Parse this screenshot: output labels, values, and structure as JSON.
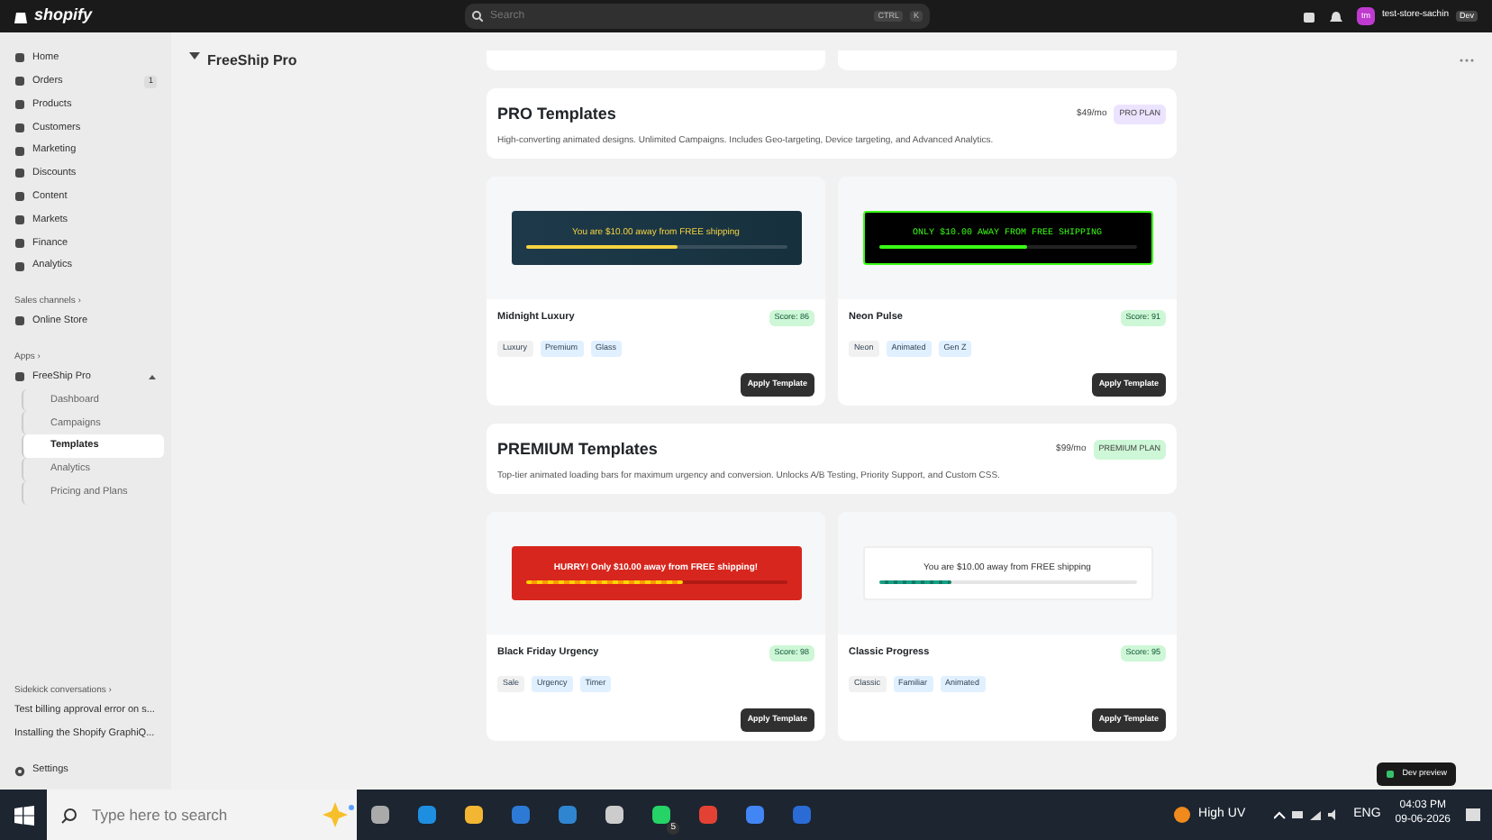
{
  "topbar": {
    "logo": "shopify",
    "search": {
      "placeholder": "Search",
      "keys": [
        "CTRL",
        "K"
      ]
    },
    "store": {
      "initials": "tm",
      "name": "test-store-sachin",
      "badge": "Dev"
    }
  },
  "sidebar": {
    "items": [
      {
        "label": "Home"
      },
      {
        "label": "Orders",
        "count": "1"
      },
      {
        "label": "Products"
      },
      {
        "label": "Customers"
      },
      {
        "label": "Marketing"
      },
      {
        "label": "Discounts"
      },
      {
        "label": "Content"
      },
      {
        "label": "Markets"
      },
      {
        "label": "Finance"
      },
      {
        "label": "Analytics"
      }
    ],
    "sales_heading": "Sales channels ›",
    "sales": [
      {
        "label": "Online Store"
      }
    ],
    "apps_heading": "Apps ›",
    "app": {
      "label": "FreeShip Pro",
      "expanded": true,
      "children": [
        {
          "label": "Dashboard",
          "selected": false
        },
        {
          "label": "Campaigns",
          "selected": false
        },
        {
          "label": "Templates",
          "selected": true
        },
        {
          "label": "Analytics",
          "selected": false
        },
        {
          "label": "Pricing and Plans",
          "selected": false
        }
      ]
    },
    "sidekick_heading": "Sidekick conversations ›",
    "sidekick": [
      "Test billing approval error on s...",
      "Installing the Shopify GraphiQ..."
    ],
    "settings": "Settings"
  },
  "app_title": "FreeShip Pro",
  "sections": [
    {
      "title": "PRO Templates",
      "price": "$49/mo",
      "plan": "PRO PLAN",
      "color": "#ece4ff",
      "description": "High-converting animated designs. Unlimited Campaigns. Includes Geo-targeting, Device targeting, and Advanced Analytics.",
      "templates": [
        {
          "name": "Midnight Luxury",
          "score": "Score: 86",
          "kind": "luxury",
          "message": "You are $10.00 away from FREE shipping",
          "level": 0.58,
          "tags": [
            {
              "label": "Luxury",
              "color": "#f1f1f1"
            },
            {
              "label": "Premium",
              "color": "#e0f0ff"
            },
            {
              "label": "Glass",
              "color": "#e0f0ff"
            }
          ],
          "button": "Apply Template"
        },
        {
          "name": "Neon Pulse",
          "score": "Score: 91",
          "kind": "neon",
          "message": "ONLY $10.00 AWAY FROM FREE SHIPPING",
          "level": 0.58,
          "tags": [
            {
              "label": "Neon",
              "color": "#f1f1f1"
            },
            {
              "label": "Animated",
              "color": "#e0f0ff"
            },
            {
              "label": "Gen Z",
              "color": "#e0f0ff"
            }
          ],
          "button": "Apply Template"
        }
      ]
    },
    {
      "title": "PREMIUM Templates",
      "price": "$99/mo",
      "plan": "PREMIUM PLAN",
      "color": "#cdf7d6",
      "description": "Top-tier animated loading bars for maximum urgency and conversion. Unlocks A/B Testing, Priority Support, and Custom CSS.",
      "templates": [
        {
          "name": "Black Friday Urgency",
          "score": "Score: 98",
          "kind": "urgency",
          "message": "HURRY! Only $10.00 away from FREE shipping!",
          "level": 0.6,
          "tags": [
            {
              "label": "Sale",
              "color": "#f1f1f1"
            },
            {
              "label": "Urgency",
              "color": "#e0f0ff"
            },
            {
              "label": "Timer",
              "color": "#e0f0ff"
            }
          ],
          "button": "Apply Template"
        },
        {
          "name": "Classic Progress",
          "score": "Score: 95",
          "kind": "classic",
          "message": "You are $10.00 away from FREE shipping",
          "level": 0.28,
          "tags": [
            {
              "label": "Classic",
              "color": "#f1f1f1"
            },
            {
              "label": "Familiar",
              "color": "#e0f0ff"
            },
            {
              "label": "Animated",
              "color": "#e0f0ff"
            }
          ],
          "button": "Apply Template"
        }
      ]
    }
  ],
  "toast": "Dev preview",
  "taskbar": {
    "search_placeholder": "Type here to search",
    "weather": "High UV",
    "language": "ENG",
    "time": "04:03 PM",
    "date": "09-06-2026",
    "whatsapp_count": "5"
  }
}
